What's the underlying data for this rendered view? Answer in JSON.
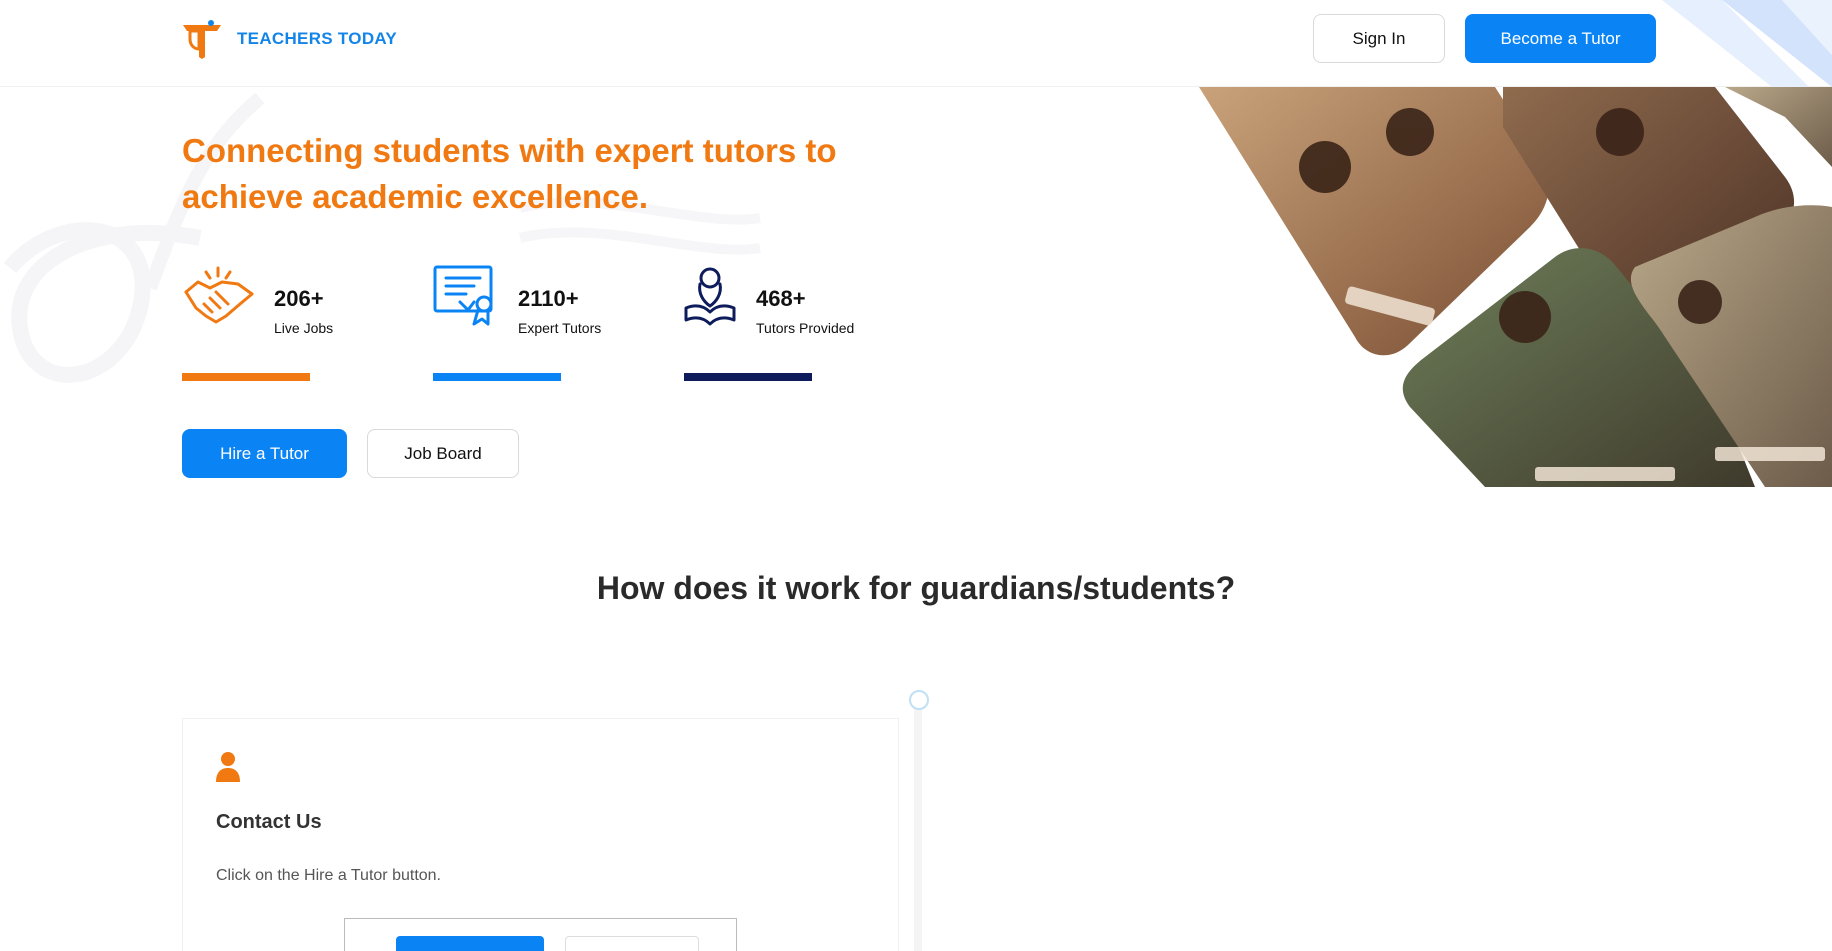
{
  "brand": {
    "name": "TEACHERS TODAY",
    "primary": "#0a84f5",
    "accent": "#f07912",
    "navy": "#0f1c5c"
  },
  "header": {
    "signin_label": "Sign In",
    "become_label": "Become a Tutor"
  },
  "hero": {
    "headline": "Connecting students with expert tutors to achieve academic excellence.",
    "stats": [
      {
        "icon": "handshake-icon",
        "value": "206+",
        "label": "Live Jobs",
        "color": "#f07912"
      },
      {
        "icon": "certificate-icon",
        "value": "2110+",
        "label": "Expert Tutors",
        "color": "#0a84f5"
      },
      {
        "icon": "reader-icon",
        "value": "468+",
        "label": "Tutors Provided",
        "color": "#0f1c5c"
      }
    ],
    "hire_label": "Hire a Tutor",
    "jobboard_label": "Job Board"
  },
  "how": {
    "title": "How does it work for guardians/students?",
    "steps": [
      {
        "icon": "user-icon",
        "title": "Contact Us",
        "text": "Click on the Hire a Tutor button."
      }
    ]
  }
}
